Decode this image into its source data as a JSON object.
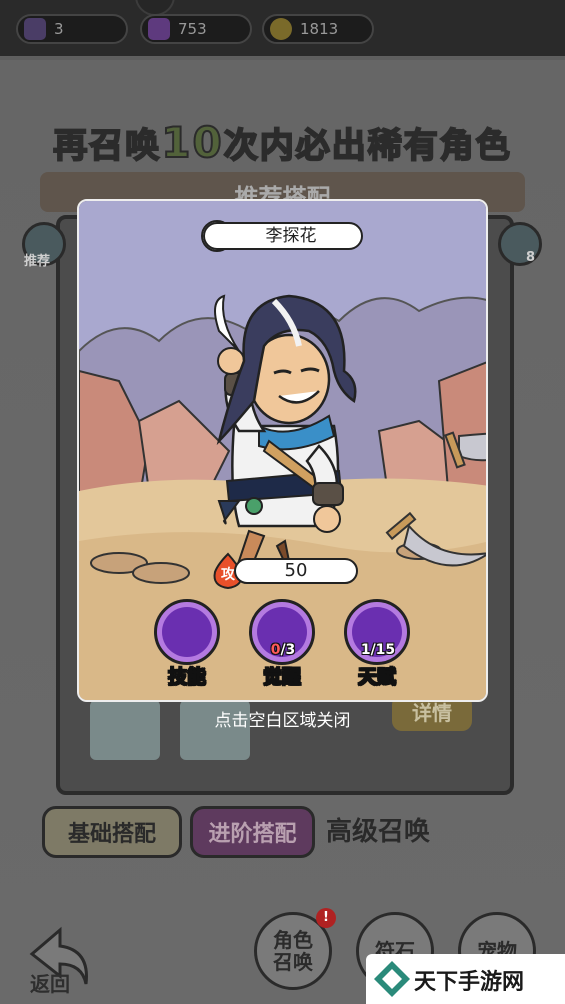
{
  "resources": [
    {
      "name": "hero-shard",
      "value": "3",
      "color": "#5a4a7a"
    },
    {
      "name": "purple-gem",
      "value": "753",
      "color": "#7a4a9a"
    },
    {
      "name": "gold-coin",
      "value": "1813",
      "color": "#a08a3a"
    }
  ],
  "banner": {
    "pre": "再召唤",
    "num": "10",
    "post": "次内必出稀有角色"
  },
  "ribbon": "推荐搭配",
  "side": {
    "left": "推荐",
    "right": "8"
  },
  "detail_button": "详情",
  "tabs": {
    "basic": "基础搭配",
    "advanced": "进阶搭配",
    "high": "高级召唤"
  },
  "bottom_nav": {
    "role": "角色召唤",
    "rune": "符石",
    "pet": "宠物",
    "badge": "!",
    "back": "返回"
  },
  "modal": {
    "character_name": "李探花",
    "attack_label": "攻",
    "attack_value": "50",
    "skills": [
      {
        "label": "技能",
        "count": ""
      },
      {
        "label": "觉醒",
        "count_current": "0",
        "count_total": "/3"
      },
      {
        "label": "天赋",
        "count_current": "1",
        "count_total": "/15"
      }
    ],
    "close_hint": "点击空白区域关闭"
  },
  "watermark": "天下手游网",
  "colors": {
    "sky": "#a9a8cf",
    "ground": "#e3c79a",
    "accent_purple": "#6a2fb0",
    "scarf": "#3a8fc8"
  }
}
